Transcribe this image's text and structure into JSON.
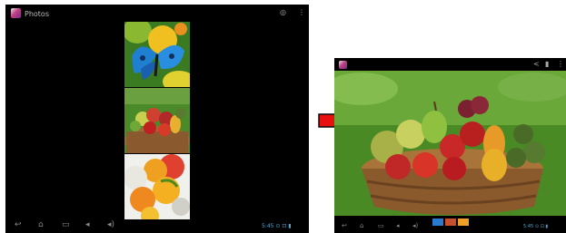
{
  "left_screen": {
    "app_title": "Photos",
    "action_icons": [
      "camera-icon",
      "overflow-menu-icon"
    ],
    "thumbnails": [
      "butterfly-photo",
      "fruit-basket-photo",
      "fruit-closeup-photo"
    ],
    "nav_buttons": [
      "back-icon",
      "home-icon",
      "recent-apps-icon",
      "volume-down-icon",
      "volume-up-icon"
    ],
    "status_text": "5:45 ⊙ ⊡ ▮"
  },
  "right_screen": {
    "action_icons": [
      "share-icon",
      "delete-icon",
      "overflow-menu-icon"
    ],
    "photo": "fruit-basket-photo",
    "nav_buttons": [
      "back-icon",
      "home-icon",
      "recent-apps-icon",
      "volume-down-icon",
      "volume-up-icon"
    ],
    "status_text": "5:45 ⊙ ⊡ ▮"
  },
  "colors": {
    "arrow_fill": "#e81010",
    "arrow_stroke": "#0a0a0a",
    "screen_bg": "#000000"
  }
}
